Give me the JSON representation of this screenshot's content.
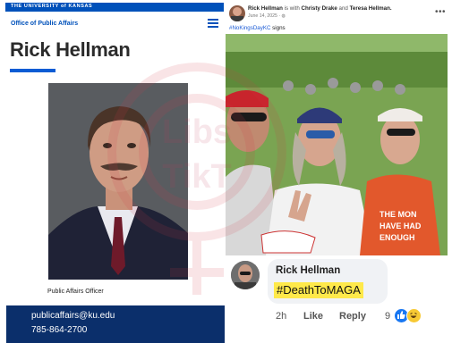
{
  "left": {
    "banner": "THE UNIVERSITY of KANSAS",
    "office": "Office of Public Affairs",
    "name": "Rick Hellman",
    "job_title": "Public Affairs Officer",
    "email": "publicaffairs@ku.edu",
    "phone": "785-864-2700",
    "colors": {
      "brand_blue": "#0051ba",
      "footer_navy": "#0b2f6b"
    }
  },
  "post": {
    "author": "Rick Hellman",
    "with_text": "is with",
    "tagged_1": "Christy Drake",
    "and_text": "and",
    "tagged_2": "Teresa Hellman.",
    "date": "June 14, 2025 ·",
    "hashtag": "#NoKingsDayKC",
    "hashtag_suffix": "signs",
    "photo_sign_text": "THE MON HAVE HAD ENOUGH"
  },
  "comment": {
    "author": "Rick Hellman",
    "text": "#DeathToMAGA",
    "time": "2h",
    "like_label": "Like",
    "reply_label": "Reply",
    "reaction_count": "9",
    "reactions": [
      "like-icon",
      "haha-icon"
    ],
    "highlight_color": "#ffe94a"
  },
  "watermark": {
    "text": "Libs of TikTok"
  }
}
